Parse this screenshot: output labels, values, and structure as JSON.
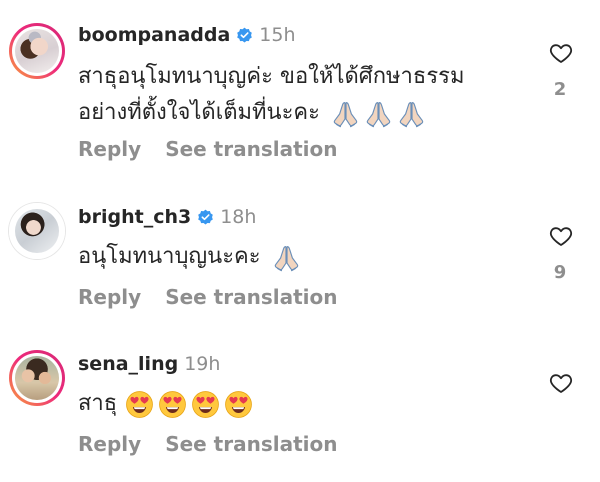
{
  "colors": {
    "text": "#262626",
    "muted": "#8e8e8e",
    "verified": "#3897f0",
    "story_ring_start": "#f9a23c",
    "story_ring_end": "#d62976"
  },
  "comments": [
    {
      "username": "boompanadda",
      "verified": true,
      "time": "15h",
      "text_lines": [
        "สาธุอนุโมทนาบุญค่ะ ขอให้ได้ศึกษาธรรม",
        "อย่างที่ตั้งใจได้เต็มที่นะคะ"
      ],
      "emoji": [
        "folded-hands-icon",
        "folded-hands-icon",
        "folded-hands-icon"
      ],
      "reply_label": "Reply",
      "translate_label": "See translation",
      "likes": "2",
      "avatar_ring": true
    },
    {
      "username": "bright_ch3",
      "verified": true,
      "time": "18h",
      "text_lines": [
        "อนุโมทนาบุญนะคะ"
      ],
      "emoji": [
        "folded-hands-icon"
      ],
      "reply_label": "Reply",
      "translate_label": "See translation",
      "likes": "9",
      "avatar_ring": false
    },
    {
      "username": "sena_ling",
      "verified": false,
      "time": "19h",
      "text_lines": [
        "สาธุ"
      ],
      "emoji": [
        "heart-eyes-icon",
        "heart-eyes-icon",
        "heart-eyes-icon",
        "heart-eyes-icon"
      ],
      "reply_label": "Reply",
      "translate_label": "See translation",
      "likes": "",
      "avatar_ring": true
    }
  ]
}
